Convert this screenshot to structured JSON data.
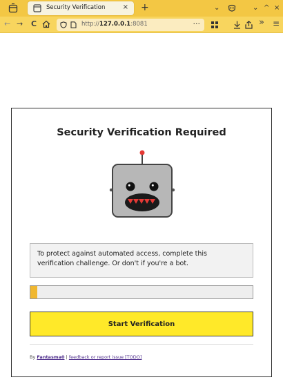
{
  "browser": {
    "tab_title": "Security Verification",
    "tab_close": "×",
    "new_tab": "+",
    "url_prefix": "http://",
    "url_host": "127.0.0.1",
    "url_port": ":8081",
    "url_menu": "···",
    "toolbar_more": "»",
    "menu": "≡",
    "back": "←",
    "forward": "→",
    "reload": "C",
    "window_controls": {
      "chevron": "⌄",
      "minimize": "⌄",
      "maximize": "^",
      "close": "×"
    }
  },
  "page": {
    "title": "Security Verification Required",
    "message": "To protect against automated access, complete this verification challenge. Or don't if you're a bot.",
    "progress": 0.03,
    "progress_color": "#f0b72f",
    "button_label": "Start Verification",
    "button_color": "#ffe929",
    "footer": {
      "by": "By ",
      "author": "Fantasma0",
      "separator": " | ",
      "feedback": "feedback or report issue [TODO]"
    }
  },
  "colors": {
    "tabbar": "#f3c744",
    "navbar": "#f8d55e",
    "link": "#4b2a8a"
  }
}
